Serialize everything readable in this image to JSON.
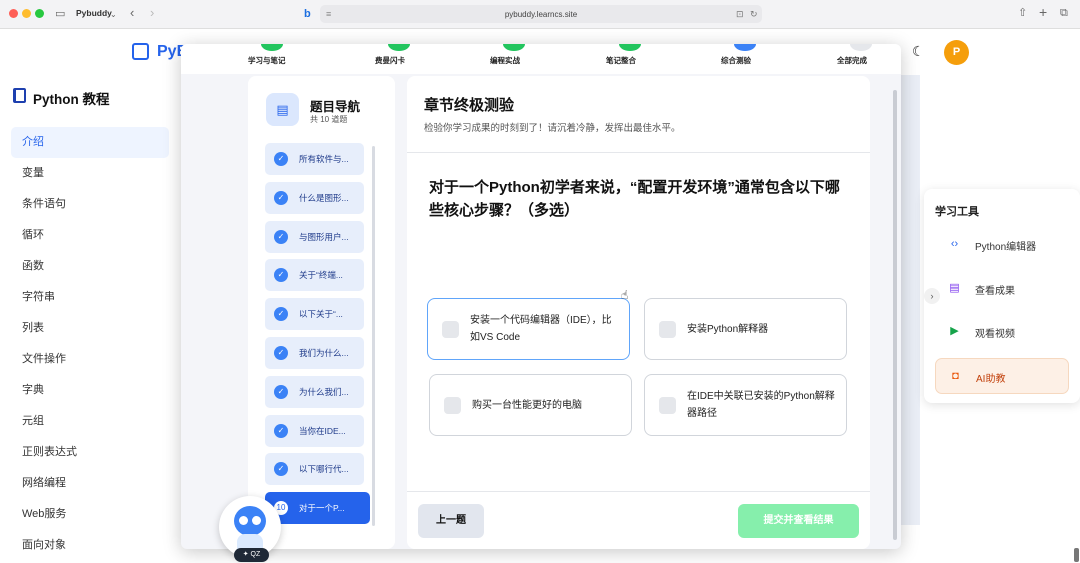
{
  "browser": {
    "tab_name": "Pybuddy",
    "url": "pybuddy.learncs.site"
  },
  "header": {
    "brand": "PyB",
    "avatar_letter": "P"
  },
  "sidebar": {
    "title": "Python 教程",
    "items": [
      {
        "label": "介绍",
        "active": true
      },
      {
        "label": "变量"
      },
      {
        "label": "条件语句"
      },
      {
        "label": "循环"
      },
      {
        "label": "函数"
      },
      {
        "label": "字符串"
      },
      {
        "label": "列表"
      },
      {
        "label": "文件操作"
      },
      {
        "label": "字典"
      },
      {
        "label": "元组"
      },
      {
        "label": "正则表达式"
      },
      {
        "label": "网络编程"
      },
      {
        "label": "Web服务"
      },
      {
        "label": "面向对象"
      }
    ]
  },
  "steps": [
    {
      "label": "学习与笔记",
      "state": "done"
    },
    {
      "label": "费曼闪卡",
      "state": "done"
    },
    {
      "label": "编程实战",
      "state": "done"
    },
    {
      "label": "笔记整合",
      "state": "done"
    },
    {
      "label": "综合测验",
      "state": "current"
    },
    {
      "label": "全部完成",
      "state": "todo"
    }
  ],
  "question_nav": {
    "title": "题目导航",
    "count": "共 10 道题",
    "questions": [
      {
        "label": "所有软件与..."
      },
      {
        "label": "什么是图形..."
      },
      {
        "label": "与图形用户..."
      },
      {
        "label": "关于“终端..."
      },
      {
        "label": "以下关于“..."
      },
      {
        "label": "我们为什么..."
      },
      {
        "label": "为什么我们..."
      },
      {
        "label": "当你在IDE..."
      },
      {
        "label": "以下哪行代..."
      },
      {
        "label": "对于一个P...",
        "current": true,
        "number": "10"
      }
    ]
  },
  "quiz": {
    "title": "章节终极测验",
    "subtitle": "检验你学习成果的时刻到了！请沉着冷静，发挥出最佳水平。",
    "question": "对于一个Python初学者来说，“配置开发环境”通常包含以下哪些核心步骤？（多选）",
    "options": [
      {
        "text": "安装一个代码编辑器（IDE），比如VS Code",
        "selected": true
      },
      {
        "text": "安装Python解释器"
      },
      {
        "text": "购买一台性能更好的电脑"
      },
      {
        "text": "在IDE中关联已安装的Python解释器路径"
      }
    ],
    "prev_label": "上一题",
    "submit_label": "提交并查看结果"
  },
  "tools": {
    "title": "学习工具",
    "items": [
      {
        "label": "Python编辑器",
        "icon": "code-icon",
        "color": "#2563eb"
      },
      {
        "label": "查看成果",
        "icon": "notebook-icon",
        "color": "#7c3aed"
      },
      {
        "label": "观看视频",
        "icon": "play-icon",
        "color": "#16a34a"
      },
      {
        "label": "AI助教",
        "icon": "robot-icon",
        "color": "#ea580c",
        "highlighted": true
      }
    ]
  },
  "mascot": {
    "badge": "✦ QZ"
  },
  "colors": {
    "accent": "#2563eb",
    "done": "#22c55e",
    "submit": "#86efac",
    "avatar": "#f59e0b"
  }
}
